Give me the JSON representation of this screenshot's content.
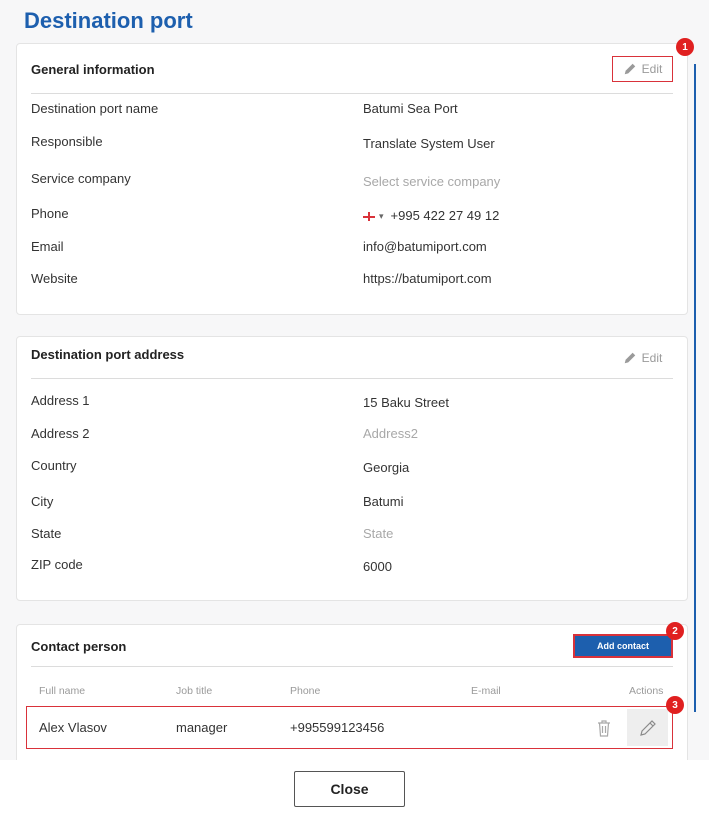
{
  "page_title": "Destination port",
  "general": {
    "title": "General information",
    "edit_label": "Edit",
    "badge": "1",
    "rows": [
      {
        "label": "Destination port name",
        "value": "Batumi Sea Port"
      },
      {
        "label": "Responsible",
        "value": "Translate System User"
      },
      {
        "label": "Service company",
        "value": "Select service company"
      },
      {
        "label": "Phone",
        "value": "+995 422 27 49 12"
      },
      {
        "label": "Email",
        "value": "info@batumiport.com"
      },
      {
        "label": "Website",
        "value": "https://batumiport.com"
      }
    ],
    "phone_dropdown_glyph": "▾"
  },
  "address": {
    "title": "Destination port address",
    "edit_label": "Edit",
    "rows": [
      {
        "label": "Address 1",
        "value": "15 Baku Street"
      },
      {
        "label": "Address 2",
        "value": "Address2"
      },
      {
        "label": "Country",
        "value": "Georgia"
      },
      {
        "label": "City",
        "value": "Batumi"
      },
      {
        "label": "State",
        "value": "State"
      },
      {
        "label": "ZIP code",
        "value": "6000"
      }
    ]
  },
  "contact": {
    "title": "Contact person",
    "add_label": "Add contact",
    "badge_add": "2",
    "badge_row": "3",
    "columns": [
      "Full name",
      "Job title",
      "Phone",
      "E-mail",
      "Actions"
    ],
    "rows": [
      {
        "full_name": "Alex Vlasov",
        "job_title": "manager",
        "phone": "+995599123456",
        "email": ""
      }
    ]
  },
  "footer": {
    "close_label": "Close"
  },
  "colors": {
    "accent": "#1d5fae",
    "highlight": "#d9323a",
    "badge": "#e02020"
  }
}
